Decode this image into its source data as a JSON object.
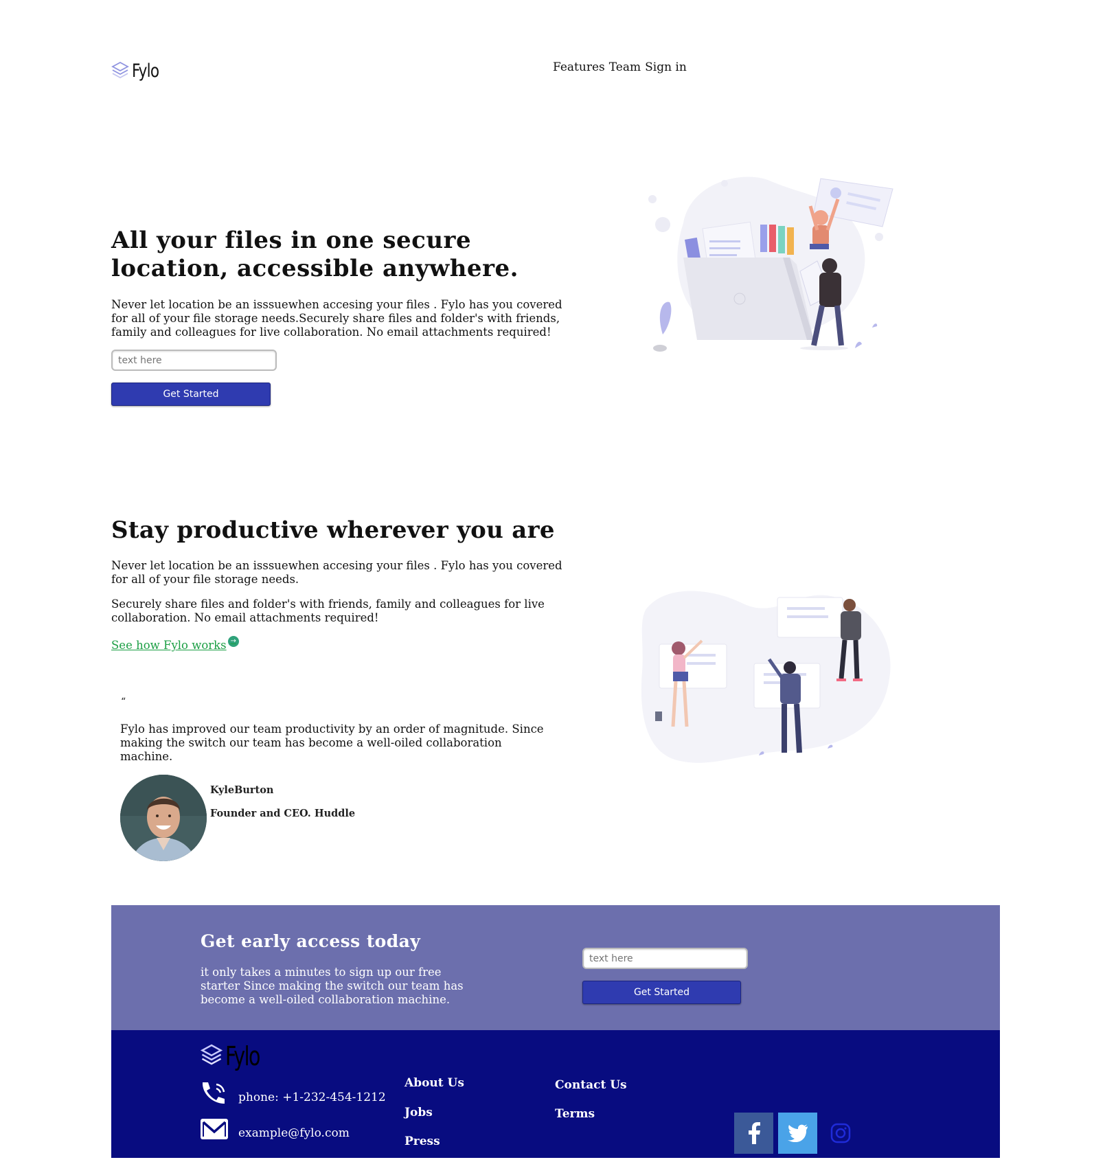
{
  "header": {
    "logo_text": "Fylo",
    "nav": [
      "Features",
      "Team",
      "Sign in"
    ]
  },
  "hero": {
    "title": "All your files in one secure location, accessible anywhere.",
    "text": "Never let location be an isssuewhen accesing your files . Fylo has you covered for all of your file storage needs.Securely share files and folder's with friends, family and colleagues for live collaboration. No email attachments required!",
    "input_placeholder": "text here",
    "button_label": "Get Started"
  },
  "productive": {
    "title": "Stay productive wherever you are",
    "paragraph1": "Never let location be an isssuewhen accesing your files . Fylo has you covered for all of your file storage needs.",
    "paragraph2": "Securely share files and folder's with friends, family and colleagues for live collaboration. No email attachments required!",
    "link_text": "See how Fylo works ",
    "link_icon": "→"
  },
  "testimonial": {
    "quote_mark": "“",
    "quote": "Fylo has improved our team productivity by an order of magnitude. Since making the switch our team has become a well-oiled collaboration machine.",
    "name": "KyleBurton",
    "role": "Founder and CEO. Huddle"
  },
  "early_access": {
    "title": "Get early access today",
    "text": "it only takes a minutes to sign up our free starter Since making the switch our team has become a well-oiled collaboration machine.",
    "input_placeholder": "text here",
    "button_label": "Get Started"
  },
  "footer": {
    "logo_text": "Fylo",
    "phone": "phone: +1-232-454-1212",
    "email": "example@fylo.com",
    "links_col1": [
      "About Us",
      "Jobs",
      "Press"
    ],
    "links_col2": [
      "Contact Us",
      "Terms"
    ],
    "social": [
      "facebook-icon",
      "twitter-icon",
      "instagram-icon"
    ]
  },
  "colors": {
    "primary_button": "#2f3bb0",
    "cta_background": "#6c6fad",
    "footer_background": "#080c80",
    "link_green": "#1a9e43",
    "facebook": "#3b5998",
    "twitter": "#4aa3e8"
  }
}
